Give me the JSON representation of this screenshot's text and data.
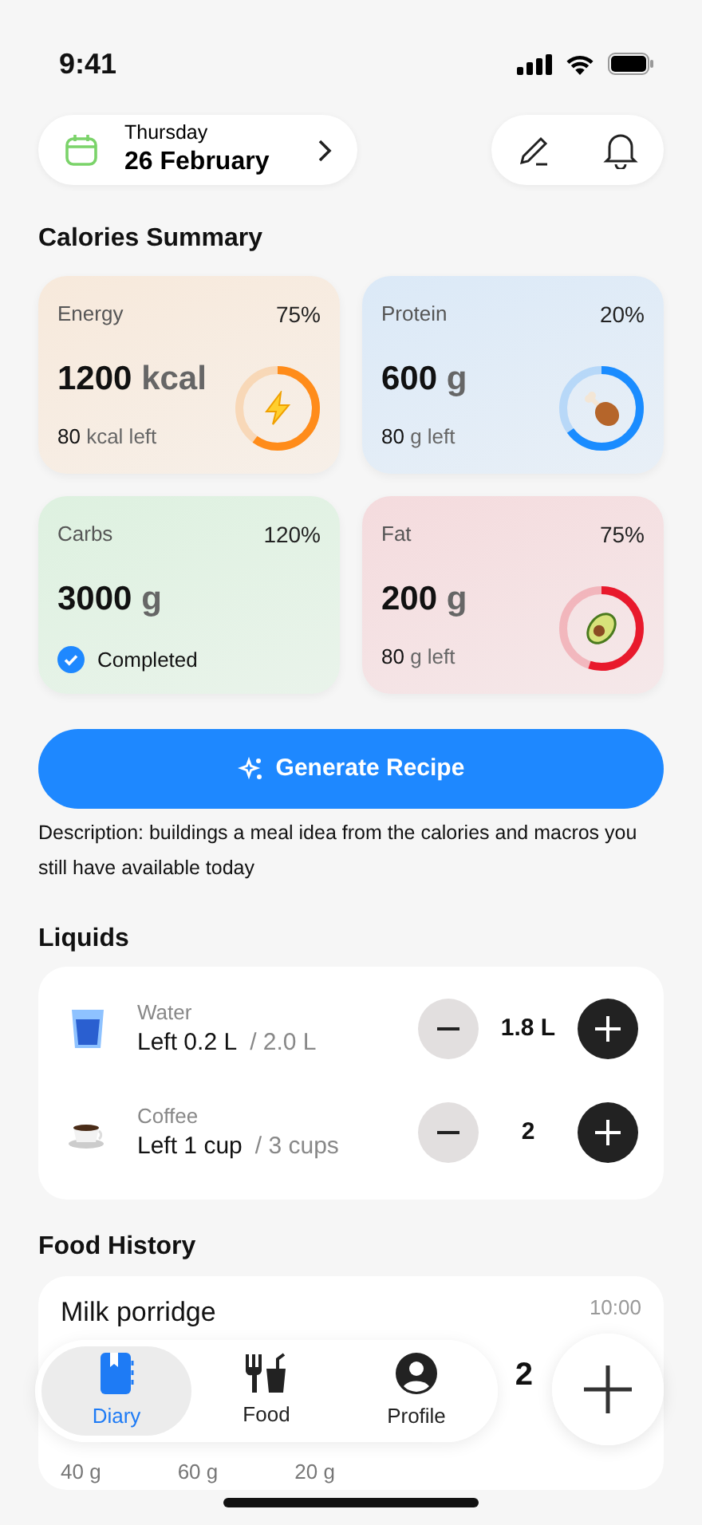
{
  "status_bar": {
    "time": "9:41"
  },
  "date_picker": {
    "weekday": "Thursday",
    "date": "26 February"
  },
  "calories_summary": {
    "title": "Calories Summary",
    "cards": [
      {
        "name": "Energy",
        "percent": "75%",
        "value": "1200",
        "unit": "kcal",
        "left_value": "80",
        "left_unit": "kcal left",
        "kind": "ring",
        "level": 0.6,
        "color": "#ff8c1a"
      },
      {
        "name": "Protein",
        "percent": "20%",
        "value": "600",
        "unit": "g",
        "left_value": "80",
        "left_unit": "g left",
        "kind": "ring",
        "level": 0.65,
        "color": "#1a8cff"
      },
      {
        "name": "Carbs",
        "percent": "120%",
        "value": "3000",
        "unit": "g",
        "status": "Completed",
        "kind": "completed"
      },
      {
        "name": "Fat",
        "percent": "75%",
        "value": "200",
        "unit": "g",
        "left_value": "80",
        "left_unit": "g left",
        "kind": "ring",
        "level": 0.55,
        "color": "#e8192c"
      }
    ]
  },
  "generate_button": {
    "label": "Generate Recipe"
  },
  "description": "Description: buildings a meal idea from the calories and macros you still have available today",
  "liquids": {
    "title": "Liquids",
    "items": [
      {
        "name": "Water",
        "left": "Left 0.2 L",
        "total": "/ 2.0 L",
        "amount": "1.8 L"
      },
      {
        "name": "Coffee",
        "left": "Left 1 cup",
        "total": "/ 3 cups",
        "amount": "2"
      }
    ]
  },
  "food_history": {
    "title": "Food History",
    "items": [
      {
        "name": "Milk porridge",
        "time": "10:00",
        "calories": "2",
        "macros": [
          "40 g",
          "60 g",
          "20 g"
        ]
      }
    ]
  },
  "tab_bar": {
    "tabs": [
      {
        "label": "Diary",
        "selected": true
      },
      {
        "label": "Food",
        "selected": false
      },
      {
        "label": "Profile",
        "selected": false
      }
    ]
  }
}
